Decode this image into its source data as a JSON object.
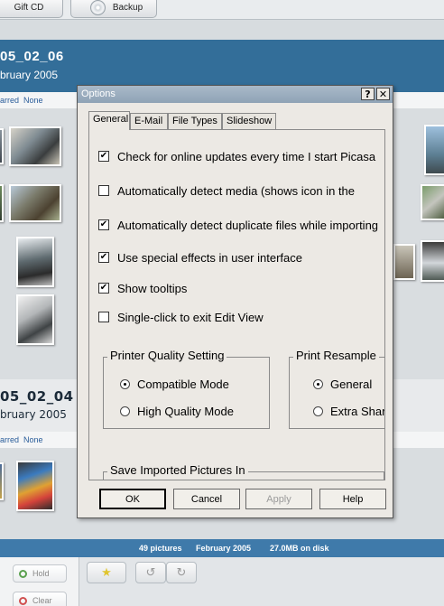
{
  "app": {
    "toolbar": {
      "gift_cd": "Gift CD",
      "backup": "Backup"
    },
    "albums": [
      {
        "title": "05_02_06",
        "date": "bruary 2005",
        "starred": "arred",
        "none": "None"
      },
      {
        "title": "05_02_04",
        "date": "bruary 2005",
        "starred": "arred",
        "none": "None"
      }
    ],
    "status": {
      "pictures": "49 pictures",
      "month": "February 2005",
      "size": "27.0MB on disk"
    },
    "side": {
      "hold": "Hold",
      "clear": "Clear"
    }
  },
  "dialog": {
    "title": "Options",
    "help_btn": "?",
    "close_btn": "✕",
    "tabs": [
      "General",
      "E-Mail",
      "File Types",
      "Slideshow"
    ],
    "options": [
      {
        "label": "Check for online updates every time I start Picasa",
        "checked": true
      },
      {
        "label": "Automatically detect media (shows icon in the",
        "checked": false
      },
      {
        "label": "Automatically detect duplicate files while importing",
        "checked": true
      },
      {
        "label": "Use special effects in user interface",
        "checked": true
      },
      {
        "label": "Show tooltips",
        "checked": true
      },
      {
        "label": "Single-click to exit Edit View",
        "checked": false
      }
    ],
    "printer_quality": {
      "legend": "Printer Quality Setting",
      "options": [
        "Compatible Mode",
        "High Quality Mode"
      ],
      "selected": "Compatible Mode"
    },
    "print_resample": {
      "legend": "Print Resample",
      "options": [
        "General",
        "Extra Sharp"
      ],
      "selected": "General"
    },
    "save_imported": {
      "legend": "Save Imported Pictures In"
    },
    "buttons": {
      "ok": "OK",
      "cancel": "Cancel",
      "apply": "Apply",
      "help": "Help"
    }
  }
}
